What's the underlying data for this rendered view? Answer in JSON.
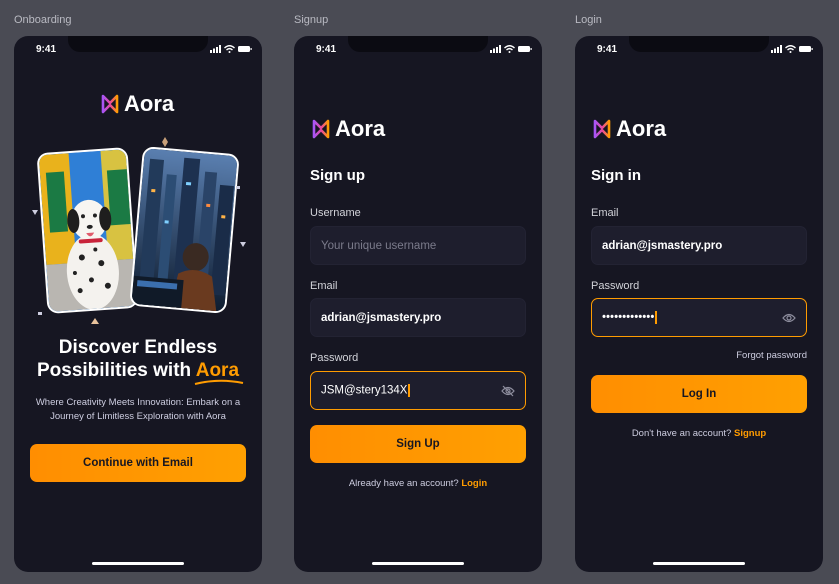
{
  "frames": {
    "onboarding_label": "Onboarding",
    "signup_label": "Signup",
    "login_label": "Login"
  },
  "status_bar": {
    "time": "9:41"
  },
  "brand": {
    "name": "Aora",
    "accent": "#ff9c01",
    "background": "#161622",
    "field_bg": "#1e1e2d"
  },
  "onboarding": {
    "headline_line1": "Discover Endless",
    "headline_line2_prefix": "Possibilities with",
    "headline_accent": "Aora",
    "subtitle": "Where Creativity Meets Innovation: Embark on a Journey of Limitless Exploration with Aora",
    "cta_label": "Continue with Email",
    "images": [
      "dalmatian-photo",
      "cyberpunk-city-photo"
    ]
  },
  "signup": {
    "title": "Sign up",
    "username_label": "Username",
    "username_placeholder": "Your unique username",
    "email_label": "Email",
    "email_value": "adrian@jsmastery.pro",
    "password_label": "Password",
    "password_value": "JSM@stery134X",
    "password_toggle_icon": "eye-off-icon",
    "button_label": "Sign Up",
    "footer_text": "Already have an account?",
    "footer_link": "Login"
  },
  "login": {
    "title": "Sign in",
    "email_label": "Email",
    "email_value": "adrian@jsmastery.pro",
    "password_label": "Password",
    "password_masked": "•••••••••••••",
    "password_toggle_icon": "eye-icon",
    "forgot_label": "Forgot password",
    "button_label": "Log In",
    "footer_text": "Don't have an account?",
    "footer_link": "Signup"
  }
}
